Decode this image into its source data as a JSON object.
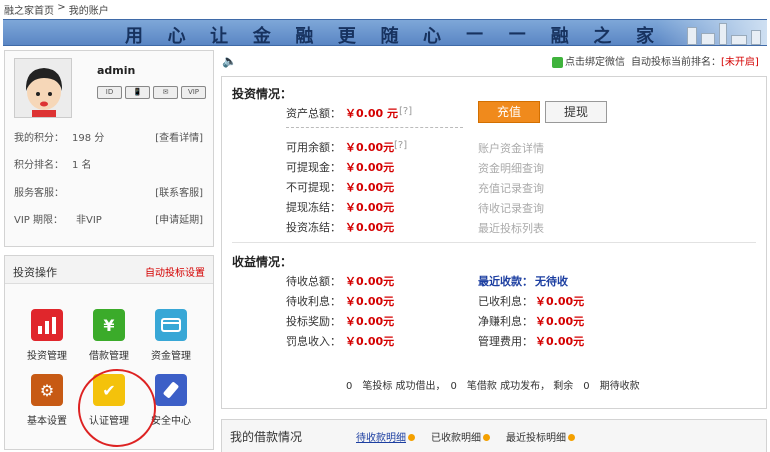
{
  "breadcrumb": {
    "home": "融之家首页",
    "separator": ">",
    "current": "我的账户"
  },
  "banner": {
    "slogan": [
      "用",
      "心",
      "让",
      "金",
      "融",
      "更",
      "随",
      "心",
      "—",
      "—",
      "融",
      "之",
      "家"
    ]
  },
  "user": {
    "name": "admin",
    "badges": [
      "ID",
      "📱",
      "✉",
      "VIP"
    ],
    "points_label": "我的积分：",
    "points_value": "198 分",
    "points_link": "[查看详情]",
    "rank_label": "积分排名：",
    "rank_value": "1 名",
    "service_label": "服务客服：",
    "service_link": "[联系客服]",
    "vip_label": "VIP 期限：",
    "vip_value": "非VIP",
    "vip_link": "[申请延期]"
  },
  "invest_ops": {
    "title": "投资操作",
    "auto_bid_link": "自动投标设置",
    "items": [
      {
        "label": "投资管理",
        "icon": "bar-chart-icon",
        "color": "#e0262c"
      },
      {
        "label": "借款管理",
        "icon": "money-bag-icon",
        "color": "#3bab2a"
      },
      {
        "label": "资金管理",
        "icon": "card-icon",
        "color": "#38a7d6"
      },
      {
        "label": "基本设置",
        "icon": "gear-icon",
        "color": "#c75a14"
      },
      {
        "label": "认证管理",
        "icon": "checkmark-icon",
        "color": "#f4c20b"
      },
      {
        "label": "安全中心",
        "icon": "usb-key-icon",
        "color": "#3c5fc7"
      }
    ]
  },
  "topbar": {
    "wechat_text": "点击绑定微信",
    "rank_text": "自动投标当前排名：",
    "rank_status": "[未开启]"
  },
  "invest_status": {
    "title": "投资情况：",
    "total_label": "资产总额：",
    "total_value": "￥0.00 元",
    "total_help": "[?]",
    "available_label": "可用余额：",
    "available_value": "￥0.00元",
    "available_help": "[?]",
    "withdrawable_label": "可提现金：",
    "withdrawable_value": "￥0.00元",
    "non_withdrawable_label": "不可提现：",
    "non_withdrawable_value": "￥0.00元",
    "withdraw_frozen_label": "提现冻结：",
    "withdraw_frozen_value": "￥0.00元",
    "invest_frozen_label": "投资冻结：",
    "invest_frozen_value": "￥0.00元",
    "charge_button": "充值",
    "withdraw_button": "提现",
    "links": [
      "账户资金详情",
      "资金明细查询",
      "充值记录查询",
      "待收记录查询",
      "最近投标列表"
    ]
  },
  "earnings": {
    "title": "收益情况：",
    "pending_total_label": "待收总额：",
    "pending_total_value": "￥0.00元",
    "pending_interest_label": "待收利息：",
    "pending_interest_value": "￥0.00元",
    "bonus_label": "投标奖励：",
    "bonus_value": "￥0.00元",
    "penalty_label": "罚息收入：",
    "penalty_value": "￥0.00元",
    "recent_label": "最近收款：",
    "recent_value": "无待收",
    "received_label": "已收利息：",
    "received_value": "￥0.00元",
    "net_label": "净赚利息：",
    "net_value": "￥0.00元",
    "fee_label": "管理费用：",
    "fee_value": "￥0.00元"
  },
  "summary": {
    "text": "0　笔投标 成功借出，　0　笔借款 成功发布，  剩余　0　期待收款"
  },
  "borrow": {
    "title": "我的借款情况",
    "tabs": [
      "待收款明细",
      "已收款明细",
      "最近投标明细"
    ]
  }
}
